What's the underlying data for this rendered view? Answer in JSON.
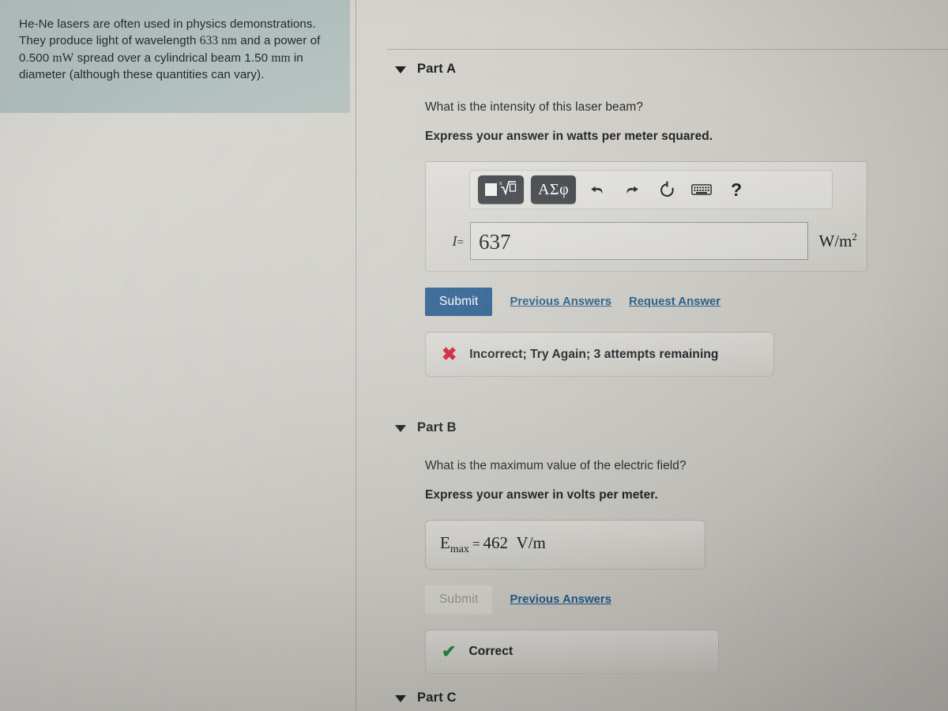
{
  "problem": {
    "text_parts": [
      {
        "t": "He-Ne lasers are often used in physics demonstrations. They produce light of wavelength ",
        "math": false
      },
      {
        "t": "633 nm",
        "math": true
      },
      {
        "t": " and a power of 0.500 ",
        "math": false
      },
      {
        "t": "mW",
        "math": true
      },
      {
        "t": " spread over a cylindrical beam 1.50 ",
        "math": false
      },
      {
        "t": "mm",
        "math": true
      },
      {
        "t": " in diameter (although these quantities can vary).",
        "math": false
      }
    ],
    "full_text": "He-Ne lasers are often used in physics demonstrations. They produce light of wavelength 633 nm and a power of 0.500 mW spread over a cylindrical beam 1.50 mm in diameter (although these quantities can vary)."
  },
  "parts": {
    "a": {
      "title": "Part A",
      "question": "What is the intensity of this laser beam?",
      "instruction": "Express your answer in watts per meter squared.",
      "toolbar": {
        "template_button": "√",
        "template_square": "■",
        "greek_button": "ΑΣφ",
        "undo": "undo-arrow",
        "redo": "redo-arrow",
        "reset": "reset-circle",
        "keyboard": "keyboard",
        "help": "?"
      },
      "variable_label": "I",
      "equals": "=",
      "answer_value": "637",
      "unit": "W/m",
      "unit_exponent": "2",
      "submit_label": "Submit",
      "previous_answers_label": "Previous Answers",
      "request_answer_label": "Request Answer",
      "feedback": {
        "icon": "x-mark",
        "text": "Incorrect; Try Again; 3 attempts remaining",
        "color": "#cc1330"
      }
    },
    "b": {
      "title": "Part B",
      "question": "What is the maximum value of the electric field?",
      "instruction": "Express your answer in volts per meter.",
      "answer_variable": "E",
      "answer_subscript": "max",
      "equals": "=",
      "answer_value": "462",
      "answer_unit": "V/m",
      "submit_label": "Submit",
      "submit_disabled": true,
      "previous_answers_label": "Previous Answers",
      "feedback": {
        "icon": "check-mark",
        "text": "Correct",
        "color": "#18803a"
      }
    },
    "c": {
      "title": "Part C"
    }
  },
  "colors": {
    "submit_blue": "#1b5288",
    "link_blue": "#19527f",
    "incorrect_red": "#cc1330",
    "correct_green": "#18803a",
    "problem_panel": "#b5c3c0"
  }
}
